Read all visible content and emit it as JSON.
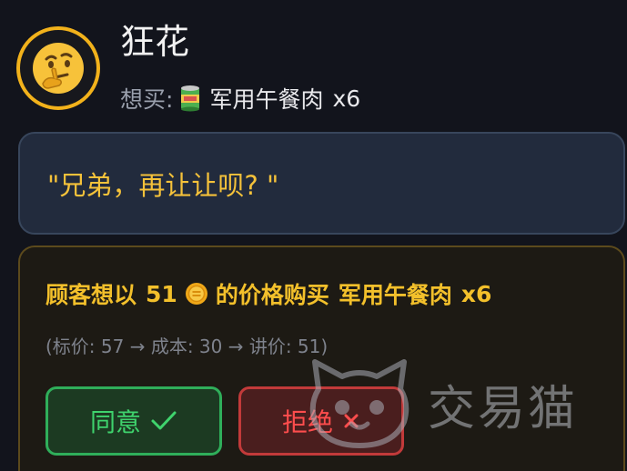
{
  "customer": {
    "name": "狂花",
    "wants_label": "想买:",
    "item_icon": "canned-meat-icon",
    "item_name": "军用午餐肉",
    "item_qty": "x6"
  },
  "dialog": {
    "text": "\"兄弟，再让让呗? \""
  },
  "offer": {
    "prefix": "顾客想以",
    "price": "51",
    "currency_icon": "coin-icon",
    "suffix": "的价格购买",
    "item_name": "军用午餐肉",
    "item_qty": "x6",
    "price_trail": "(标价: 57 → 成本: 30 → 讲价: 51)"
  },
  "buttons": {
    "agree_label": "同意",
    "reject_label": "拒绝"
  },
  "watermark": {
    "text": "交易猫"
  },
  "colors": {
    "accent_gold": "#f3c02b",
    "agree_green": "#3fd36d",
    "reject_red": "#ff4d4d",
    "bubble_bg": "#222b3d"
  }
}
